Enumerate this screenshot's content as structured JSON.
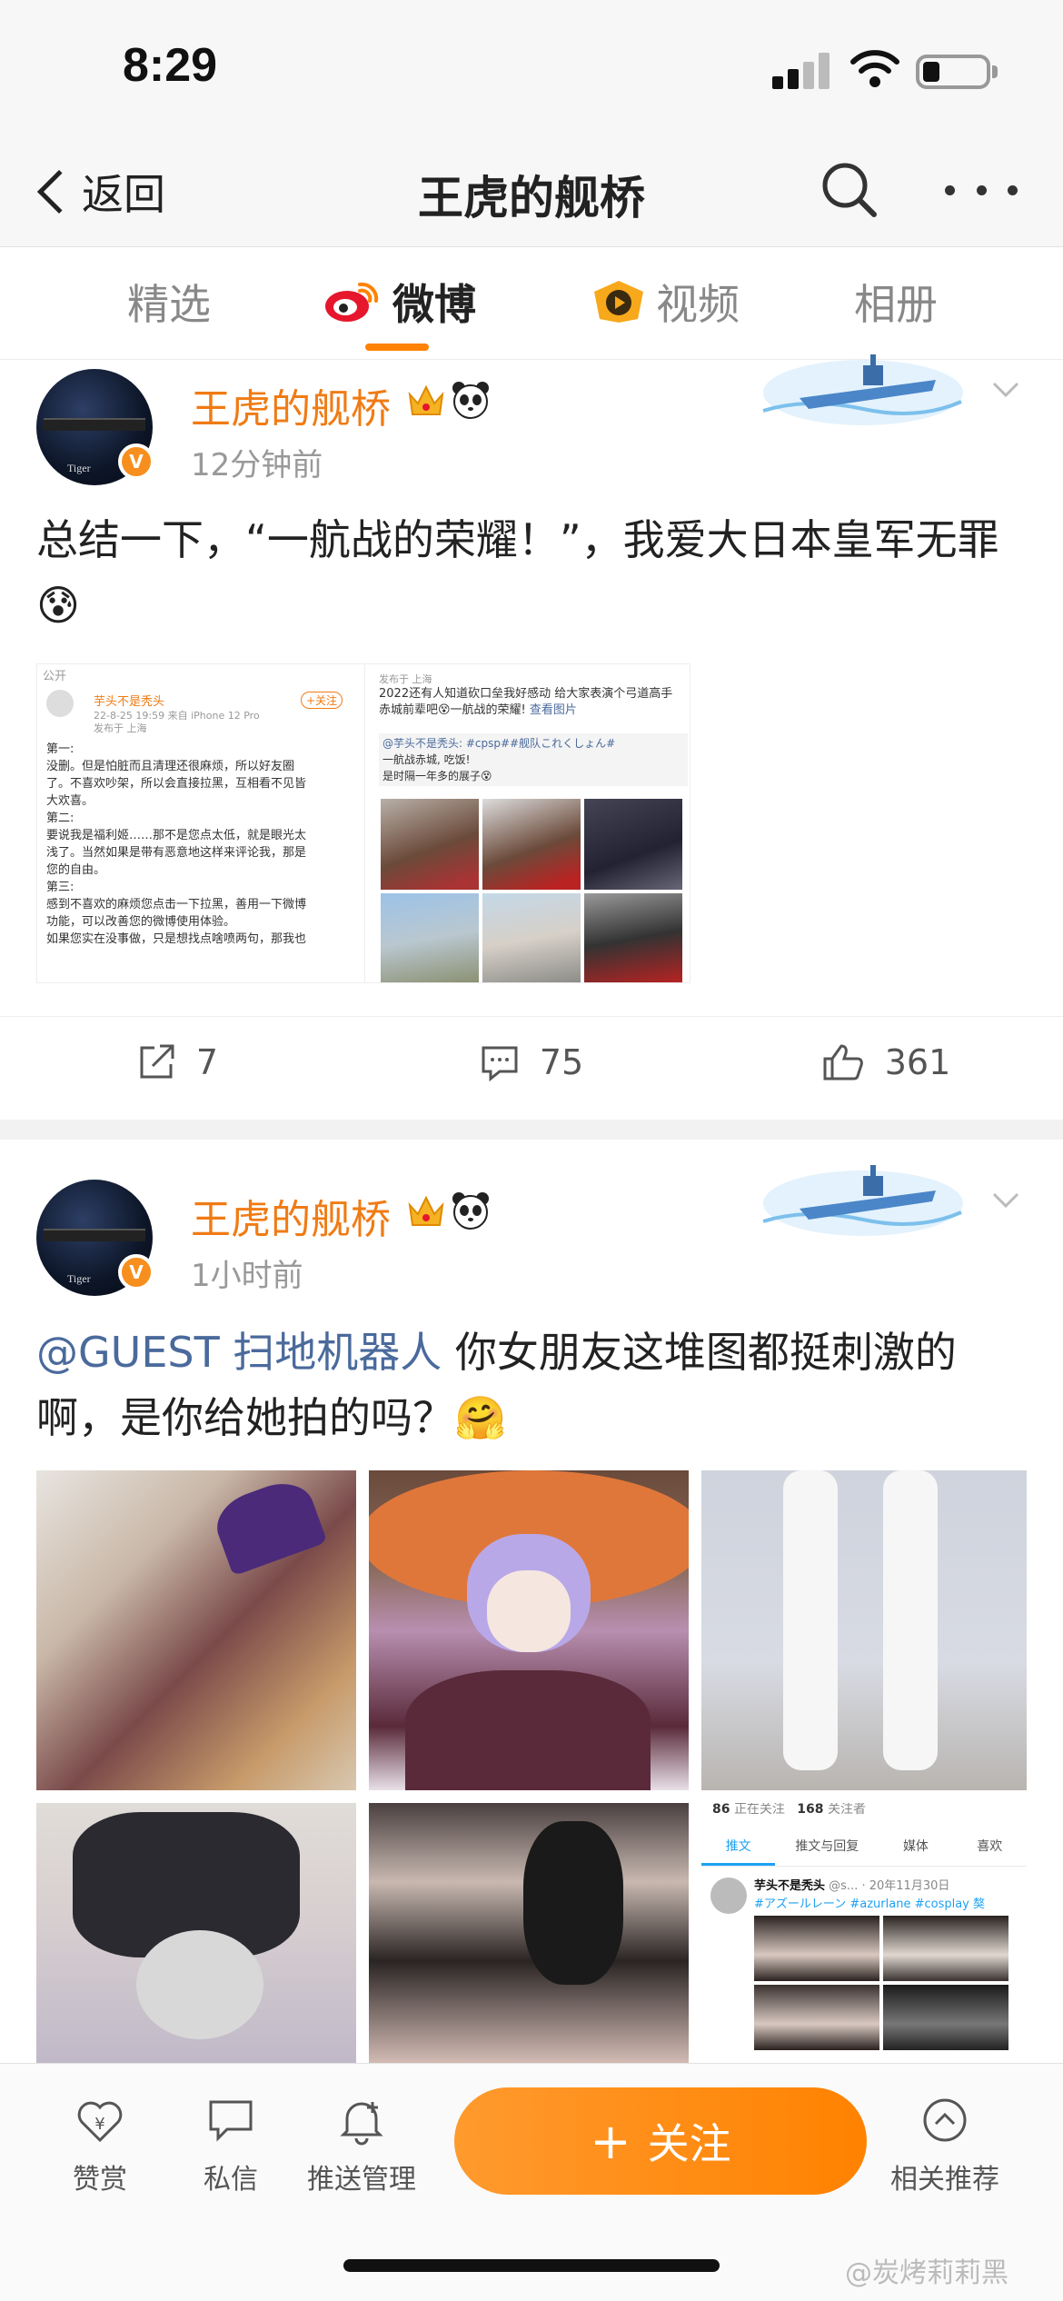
{
  "status_bar": {
    "time": "8:29"
  },
  "nav": {
    "back_label": "返回",
    "title": "王虎的舰桥"
  },
  "tabs": [
    {
      "label": "精选"
    },
    {
      "label": "微博"
    },
    {
      "label": "视频"
    },
    {
      "label": "相册"
    }
  ],
  "posts": [
    {
      "username": "王虎的舰桥",
      "timestamp": "12分钟前",
      "text": "总结一下，“一航战的荣耀！”，我爱大日本皇军无罪😰",
      "embedded": {
        "visibility": "公开",
        "author": "芋头不是秃头",
        "follow": "+关注",
        "meta": "22-8-25 19:59  来自 iPhone 12 Pro",
        "location": "发布于 上海",
        "body_lines": [
          "第一:",
          "没删。但是怕脏而且清理还很麻烦，所以好友圈",
          "了。不喜欢吵架，所以会直接拉黑，互相看不见皆",
          "大欢喜。",
          "第二:",
          "要说我是福利姬……那不是您点太低，就是眼光太",
          "浅了。当然如果是带有恶意地这样来评论我，那是",
          "您的自由。",
          "第三:",
          "感到不喜欢的麻烦您点击一下拉黑，善用一下微博",
          "功能，可以改善您的微博使用体验。",
          "如果您实在没事做，只是想找点啥喷两句，那我也"
        ],
        "right_location": "发布于 上海",
        "right_text": "2022还有人知道砍口垒我好感动 给大家表演个弓道高手赤城前辈吧😵一航战的荣耀!",
        "right_link": "查看图片",
        "quote_lines": [
          "@芋头不是秃头: #cpsp##舰队これくしょん#",
          "一航战赤城, 吃饭!",
          "是时隔一年多的展子😵"
        ]
      },
      "counts": {
        "repost": "7",
        "comment": "75",
        "like": "361"
      }
    },
    {
      "username": "王虎的舰桥",
      "timestamp": "1小时前",
      "mention": "@GUEST 扫地机器人",
      "text": " 你女朋友这堆图都挺刺激的啊，是你给她拍的吗？🤗",
      "screenshot": {
        "following": "86",
        "following_label": "正在关注",
        "followers": "168",
        "followers_label": "关注者",
        "tabs": [
          "推文",
          "推文与回复",
          "媒体",
          "喜欢"
        ],
        "author": "芋头不是秃头",
        "handle": "@s...",
        "date": "· 20年11月30日",
        "hashtags": "#アズールレーン #azurlane #cosplay 獒"
      }
    }
  ],
  "toolbar": {
    "reward": "赞赏",
    "message": "私信",
    "push": "推送管理",
    "follow": "关注",
    "follow_plus": "+",
    "related": "相关推荐"
  },
  "watermark": "@炭烤莉莉黑",
  "colors": {
    "accent": "#ff8200",
    "username": "#f07b14",
    "mention": "#4a6a9c"
  }
}
